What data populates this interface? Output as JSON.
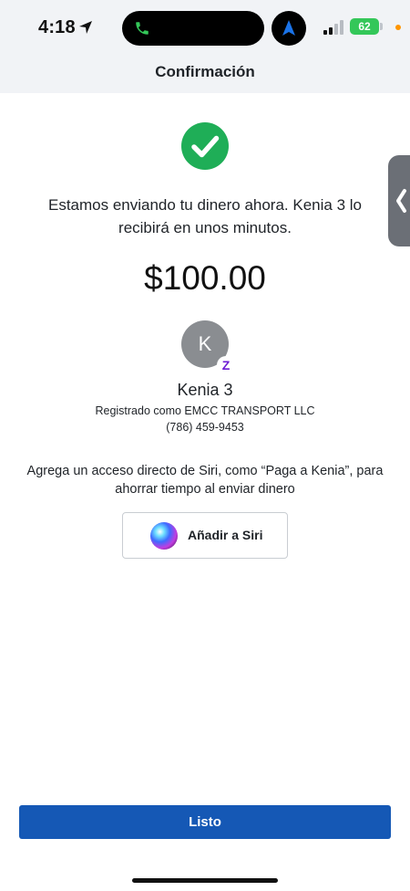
{
  "status_bar": {
    "time": "4:18",
    "battery": "62"
  },
  "header": {
    "title": "Confirmación"
  },
  "confirmation": {
    "message": "Estamos enviando tu dinero ahora. Kenia 3 lo recibirá en unos minutos.",
    "amount": "$100.00"
  },
  "recipient": {
    "initial": "K",
    "badge": "Z",
    "name": "Kenia 3",
    "registered_as": "Registrado como EMCC TRANSPORT LLC",
    "phone": "(786) 459-9453"
  },
  "siri": {
    "hint": "Agrega un acceso directo de Siri, como “Paga a Kenia”, para ahorrar tiempo al enviar dinero",
    "button_label": "Añadir a Siri"
  },
  "footer": {
    "done_label": "Listo"
  },
  "icons": {
    "location": "location-arrow-icon",
    "call": "phone-icon",
    "navigation": "navigation-arrow-icon",
    "signal": "cellular-signal-icon",
    "success": "checkmark-circle-icon",
    "siri": "siri-icon",
    "collapse": "chevron-left-icon"
  },
  "colors": {
    "primary": "#1558b5",
    "success": "#1fae57",
    "zelle": "#6d1ed4",
    "battery": "#34c759",
    "header_bg": "#f1f3f6"
  }
}
